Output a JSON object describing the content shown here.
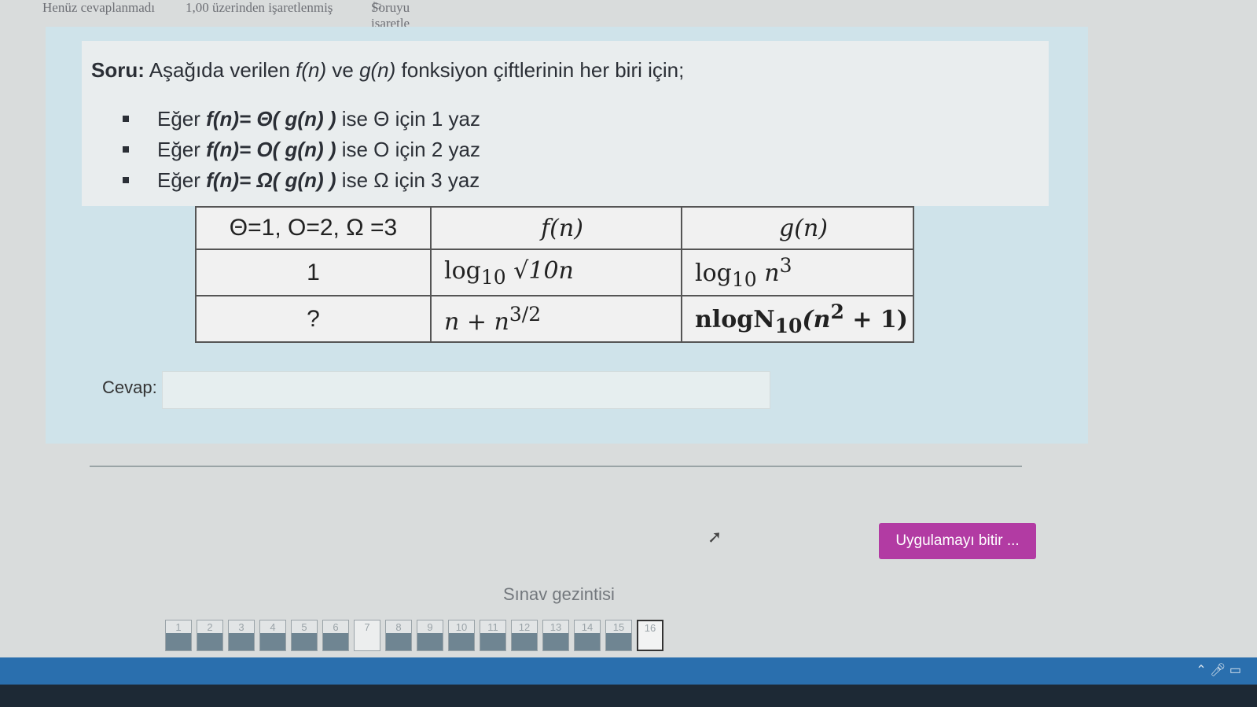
{
  "status": {
    "answer_state": "Henüz cevaplanmadı",
    "points": "1,00 üzerinden işaretlenmiş",
    "flag_label": "Soruyu işaretle"
  },
  "question": {
    "label": "Soru:",
    "prompt_parts": [
      "Aşağıda verilen ",
      "f(n)",
      " ve ",
      "g(n)",
      " fonksiyon çiftlerinin her biri için;"
    ],
    "bullets": [
      {
        "prefix": "Eğer ",
        "formula": "f(n)= Θ( g(n) )",
        "suffix": " ise Θ için 1 yaz"
      },
      {
        "prefix": "Eğer ",
        "formula": "f(n)= O( g(n) )",
        "suffix": " ise O için 2 yaz"
      },
      {
        "prefix": "Eğer ",
        "formula": "f(n)= Ω( g(n) )",
        "suffix": " ise Ω için 3 yaz"
      }
    ]
  },
  "table": {
    "headers": [
      "Θ=1, O=2, Ω =3",
      "f(n)",
      "g(n)"
    ],
    "rows": [
      {
        "answer": "1",
        "f_main": "log",
        "f_sub": "10",
        "f_rest": "√10n",
        "g_main": "log",
        "g_sub": "10",
        "g_base": "n",
        "g_sup": "3"
      },
      {
        "answer": "?",
        "f_base": "n + n",
        "f_sup": "3/2",
        "g_main": "nlogN",
        "g_sub": "10",
        "g_open": "(n",
        "g_sup": "2",
        "g_close": " + 1)"
      }
    ]
  },
  "answer": {
    "label": "Cevap:",
    "value": ""
  },
  "finish_button": "Uygulamayı bitir ...",
  "nav": {
    "title": "Sınav gezintisi",
    "buttons": [
      "1",
      "2",
      "3",
      "4",
      "5",
      "6",
      "7",
      "8",
      "9",
      "10",
      "11",
      "12",
      "13",
      "14",
      "15",
      "16"
    ],
    "current": "16",
    "unanswered": [
      "7"
    ]
  },
  "colors": {
    "accent": "#b23ba3",
    "panel": "#cfe3ea"
  }
}
